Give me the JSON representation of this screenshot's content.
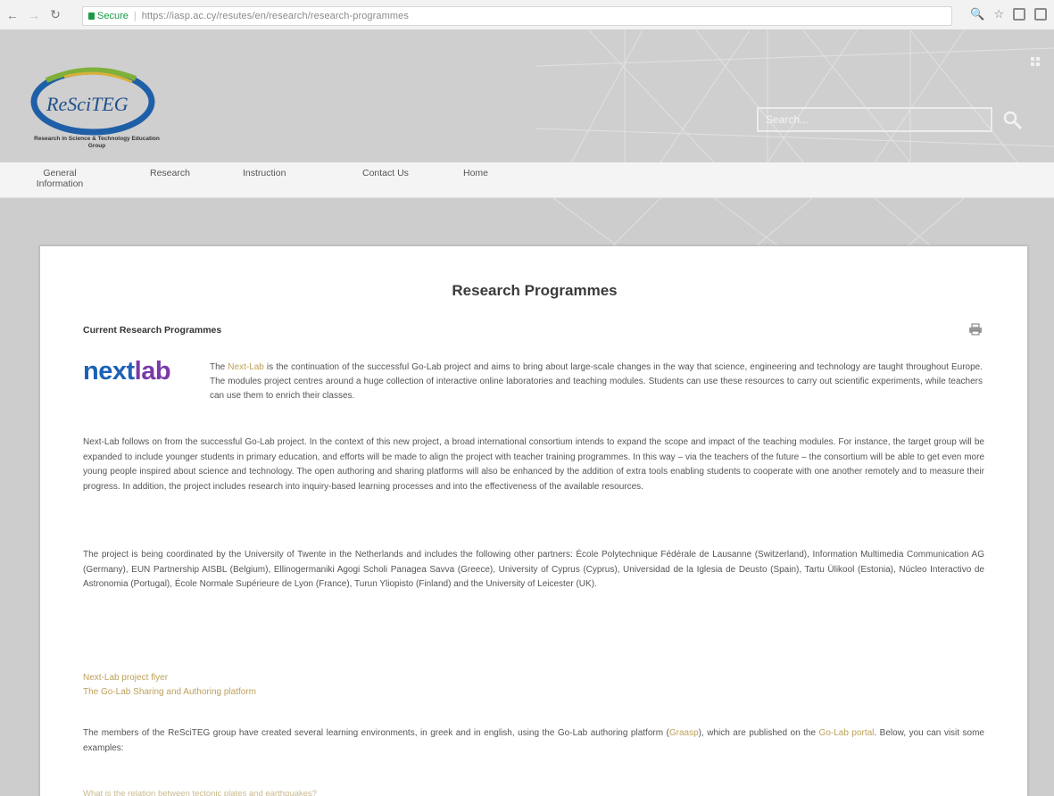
{
  "browser": {
    "secure_label": "Secure",
    "url": "https://iasp.ac.cy/resutes/en/research/research-programmes"
  },
  "header": {
    "logo_text": "ReSciTEG",
    "logo_caption": "Research in Science & Technology Education Group",
    "search_placeholder": "Search..."
  },
  "menu": {
    "items": [
      {
        "label": "General Information"
      },
      {
        "label": "Research"
      },
      {
        "label": "Instruction"
      },
      {
        "label": "Contact Us"
      },
      {
        "label": "Home"
      }
    ]
  },
  "page": {
    "title": "Research Programmes",
    "sub_heading": "Current Research Programmes",
    "logo_next": "next",
    "logo_lab": "lab",
    "intro_before": "The ",
    "intro_link": "Next-Lab",
    "intro_after": " is the continuation of the successful Go-Lab project and aims to bring about large-scale changes in the way that science, engineering and technology are taught throughout Europe. The modules project centres around a huge collection of interactive online laboratories and teaching modules. Students can use these resources to carry out scientific experiments, while teachers can use them to enrich their classes.",
    "para1": "Next-Lab follows on from the successful Go-Lab project. In the context of this new project, a broad international consortium intends to expand the scope and impact of the teaching modules. For instance, the target group will be expanded to include younger students in primary education, and efforts will be made to align the project with teacher training programmes. In this way – via the teachers of the future – the consortium will be able to get even more young people inspired about science and technology. The open authoring and sharing platforms will also be enhanced by the addition of extra tools enabling students to cooperate with one another remotely and to measure their progress. In addition, the project includes research into inquiry-based learning processes and into the effectiveness of the available resources.",
    "para2": "The project is being coordinated by the University of Twente in the Netherlands and includes the following other partners: École Polytechnique Fédérale de Lausanne (Switzerland), Information Multimedia Communication AG (Germany), EUN Partnership AISBL (Belgium), Ellinogermaniki Agogi Scholi Panagea Savva (Greece), University of Cyprus (Cyprus), Universidad de la Iglesia de Deusto (Spain), Tartu Ülikool (Estonia), Núcleo Interactivo de Astronomia (Portugal), École Normale Supérieure de Lyon (France), Turun Yliopisto (Finland) and the University of Leicester (UK).",
    "link1": "Next-Lab project flyer",
    "link2": "The Go-Lab Sharing and Authoring platform",
    "para3_before": "The members of the ReSciTEG group have created several learning environments, in greek and in english, using the Go-Lab authoring platform (",
    "para3_link1": "Graasp",
    "para3_mid": "), which are published on the ",
    "para3_link2": "Go-Lab portal",
    "para3_after": ". Below, you can visit some examples:",
    "faded_link": "What is the relation between tectonic plates and earthquakes?"
  },
  "colors": {
    "link": "#bda15a",
    "next": "#1d61b6",
    "lab": "#7a3aa7",
    "secure": "#1a9b48"
  }
}
